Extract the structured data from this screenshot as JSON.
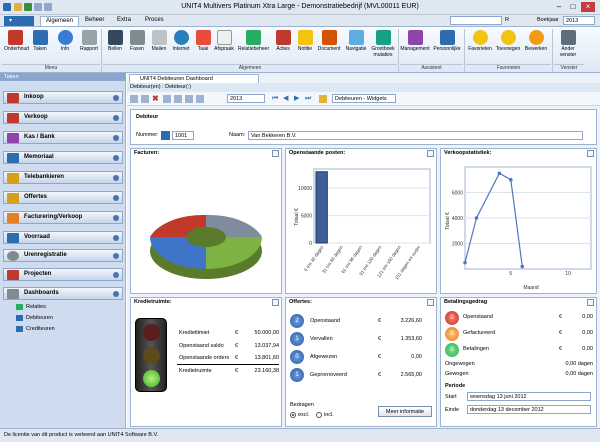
{
  "window": {
    "title": "UNIT4 Multivers Platinum Xtra Large - Demonstratiebedrijf (MVL00011 EUR)"
  },
  "ribbon_tabs": [
    {
      "label": "Algemeen"
    },
    {
      "label": "Beheer"
    },
    {
      "label": "Extra"
    },
    {
      "label": "Proces"
    }
  ],
  "search": {
    "label": "R",
    "year_label": "Boekjaar",
    "year_value": "2013"
  },
  "ribbon_buttons": [
    {
      "label": "Onderhoud",
      "icon": "wrench-icon"
    },
    {
      "label": "Taken",
      "icon": "tasks-icon"
    },
    {
      "label": "Info",
      "icon": "info-icon"
    },
    {
      "label": "Rapport",
      "icon": "report-icon"
    },
    {
      "label": "Bellen",
      "icon": "phone-icon"
    },
    {
      "label": "Faxen",
      "icon": "fax-icon"
    },
    {
      "label": "Mailen",
      "icon": "mail-icon"
    },
    {
      "label": "Internet",
      "icon": "globe-icon"
    },
    {
      "label": "Taak",
      "icon": "task-icon"
    },
    {
      "label": "Afspraak",
      "icon": "calendar-icon"
    },
    {
      "label": "Relatiebeheer",
      "icon": "relations-icon"
    },
    {
      "label": "Acties",
      "icon": "flag-icon"
    },
    {
      "label": "Notitie",
      "icon": "note-icon"
    },
    {
      "label": "Document",
      "icon": "document-icon"
    },
    {
      "label": "Navigatie",
      "icon": "navigation-icon"
    },
    {
      "label": "Grootboek mutaties",
      "icon": "ledger-icon"
    },
    {
      "label": "Management",
      "icon": "management-icon"
    },
    {
      "label": "Persoonlijke",
      "icon": "person-icon"
    },
    {
      "label": "Favorieten",
      "icon": "star-icon"
    },
    {
      "label": "Toevoegen",
      "icon": "star-add-icon"
    },
    {
      "label": "Bewerken",
      "icon": "star-edit-icon"
    },
    {
      "label": "Ander venster",
      "icon": "window-icon"
    }
  ],
  "ribbon_groups": [
    {
      "label": "Menu"
    },
    {
      "label": "Algemeen"
    },
    {
      "label": "Assistent"
    },
    {
      "label": "Favorieten"
    },
    {
      "label": "Venster"
    }
  ],
  "left_pane": {
    "header": "Taken",
    "items": [
      {
        "label": "Inkoop",
        "color": "#c0392b"
      },
      {
        "label": "Verkoop",
        "color": "#c0392b"
      },
      {
        "label": "Kas / Bank",
        "color": "#8e44ad"
      },
      {
        "label": "Memoriaal",
        "color": "#2c6cb0"
      },
      {
        "label": "Telebankieren",
        "color": "#d4a017"
      },
      {
        "label": "Offertes",
        "color": "#d4a017"
      },
      {
        "label": "Facturering/Verkoop",
        "color": "#e67e22"
      },
      {
        "label": "Voorraad",
        "color": "#2c6cb0"
      },
      {
        "label": "Urenregistratie",
        "color": "#7f8c8d"
      },
      {
        "label": "Projecten",
        "color": "#c0392b"
      },
      {
        "label": "Dashboards",
        "color": "#7f8c8d"
      }
    ],
    "sub_items": [
      {
        "label": "Relaties"
      },
      {
        "label": "Debiteuren"
      },
      {
        "label": "Crediteuren"
      }
    ]
  },
  "doc_tab": {
    "label": "UNIT4 Debiteuren Dashboard"
  },
  "breadcrumb": {
    "text": "Debiteur(en) : Debiteur(:)"
  },
  "toolbar": {
    "year": "2013",
    "view": "Debiteuren - Widgets"
  },
  "debiteur": {
    "section": "Debiteur",
    "nummer_label": "Nummer:",
    "nummer_value": "1001",
    "naam_label": "Naam:",
    "naam_value": "Van Bekkeren B.V."
  },
  "facturen": {
    "title": "Facturen:"
  },
  "openstaande_posten": {
    "title": "Openstaande posten:",
    "ylabel": "Totaal €",
    "yticks": [
      "10000",
      "5000",
      "0"
    ],
    "categories": [
      "0 t/m 30 dagen",
      "31 t/m 60 dagen",
      "61 t/m 90 dagen",
      "91 t/m 120 dagen",
      "121 t/m 150 dagen",
      "151 dagen en ouder"
    ],
    "values": [
      13000,
      0,
      0,
      0,
      0,
      0
    ]
  },
  "verkoopstatistiek": {
    "title": "Verkoopstatistiek:",
    "ylabel": "Totaal €",
    "xlabel": "Maand",
    "yticks": [
      "6000",
      "4000",
      "2000"
    ],
    "xticks": [
      "5",
      "10"
    ],
    "points": [
      [
        1,
        500
      ],
      [
        2,
        4000
      ],
      [
        4,
        7500
      ],
      [
        5,
        7000
      ],
      [
        6,
        200
      ]
    ]
  },
  "kredietruimte": {
    "title": "Kredietruimte:",
    "rows": [
      {
        "label": "Kredietlimiet",
        "cur": "€",
        "value": "50.000,00"
      },
      {
        "label": "Openstaand saldo",
        "cur": "€",
        "value": "13.037,94"
      },
      {
        "label": "Openstaande orders",
        "cur": "€",
        "value": "13.801,60"
      },
      {
        "label": "Kredietruimte",
        "cur": "€",
        "value": "23.160,38"
      }
    ]
  },
  "offertes": {
    "title": "Offertes:",
    "rows": [
      {
        "n": "2",
        "label": "Openstaand",
        "cur": "€",
        "value": "3.226,60"
      },
      {
        "n": "1",
        "label": "Vervallen",
        "cur": "€",
        "value": "1.353,60"
      },
      {
        "n": "0",
        "label": "Afgewezen",
        "cur": "€",
        "value": "0,00"
      },
      {
        "n": "1",
        "label": "Geprornoveerd",
        "cur": "€",
        "value": "2.565,00"
      }
    ],
    "bedragen_label": "Bedragen",
    "excl_label": "excl.",
    "incl_label": "incl.",
    "more_button": "Meer informatie"
  },
  "betalingsgedrag": {
    "title": "Betalingsgedrag",
    "rows": [
      {
        "n": "0",
        "label": "Openstaand",
        "cur": "€",
        "value": "0,00",
        "color": "#c0392b"
      },
      {
        "n": "0",
        "label": "Gefactureerd",
        "cur": "€",
        "value": "0,00",
        "color": "#e67e22"
      },
      {
        "n": "0",
        "label": "Betalingen",
        "cur": "€",
        "value": "0,00",
        "color": "#27ae60"
      }
    ],
    "ongewogen_label": "Ongewogen",
    "ongewogen_value": "0,00 dagen",
    "gewogen_label": "Gewogen",
    "gewogen_value": "0,00 dagen",
    "periode_label": "Periode",
    "start_label": "Start",
    "start_value": "woensdag 13 juni 2012",
    "einde_label": "Einde",
    "einde_value": "donderdag 13 december 2012"
  },
  "status": {
    "text": "De licentie van dit product is verleend aan UNIT4 Software B.V."
  }
}
